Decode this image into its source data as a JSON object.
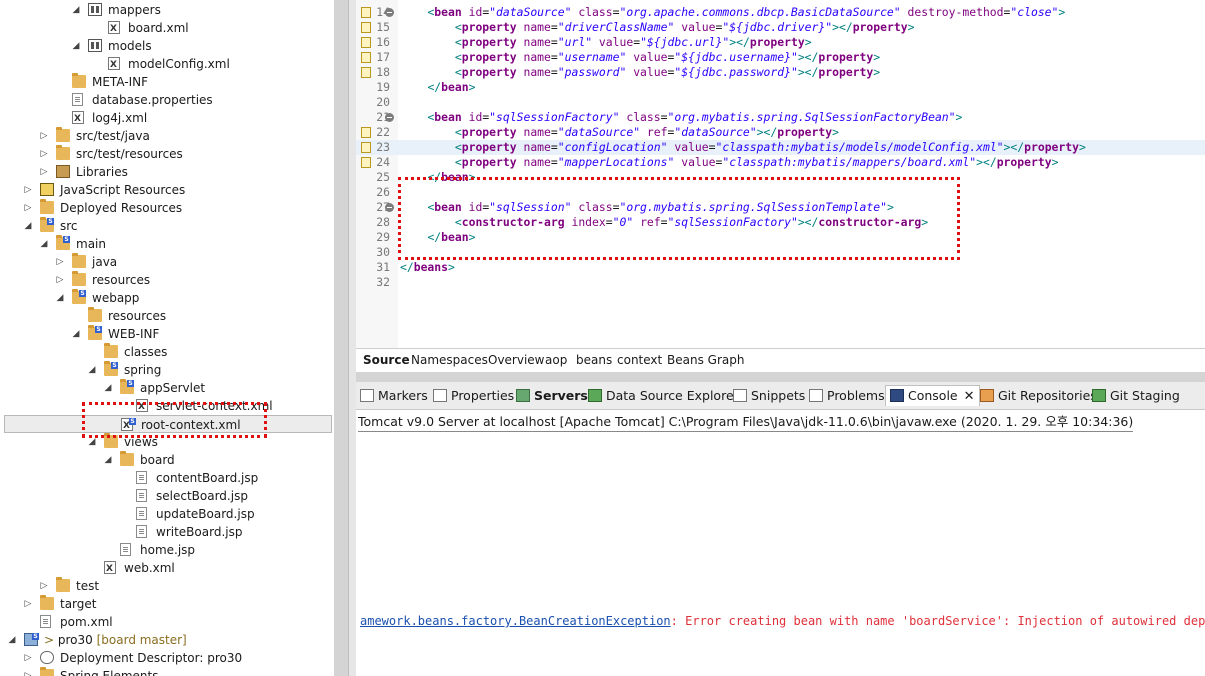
{
  "explorer": {
    "rows": [
      {
        "label": "mappers",
        "icon": "package-icon"
      },
      {
        "label": "board.xml",
        "icon": "xml-file-icon"
      },
      {
        "label": "models",
        "icon": "package-icon"
      },
      {
        "label": "modelConfig.xml",
        "icon": "xml-file-icon"
      },
      {
        "label": "META-INF",
        "icon": "folder-icon"
      },
      {
        "label": "database.properties",
        "icon": "file-icon"
      },
      {
        "label": "log4j.xml",
        "icon": "xml-file-icon"
      },
      {
        "label": "src/test/java",
        "icon": "source-folder-icon"
      },
      {
        "label": "src/test/resources",
        "icon": "source-folder-icon"
      },
      {
        "label": "Libraries",
        "icon": "library-icon"
      },
      {
        "label": "JavaScript Resources",
        "icon": "javascript-icon"
      },
      {
        "label": "Deployed Resources",
        "icon": "folder-icon"
      },
      {
        "label": "src",
        "icon": "folder-icon"
      },
      {
        "label": "main",
        "icon": "folder-icon"
      },
      {
        "label": "java",
        "icon": "folder-icon"
      },
      {
        "label": "resources",
        "icon": "folder-icon"
      },
      {
        "label": "webapp",
        "icon": "folder-icon"
      },
      {
        "label": "resources",
        "icon": "folder-icon"
      },
      {
        "label": "WEB-INF",
        "icon": "folder-icon"
      },
      {
        "label": "classes",
        "icon": "folder-icon"
      },
      {
        "label": "spring",
        "icon": "folder-icon"
      },
      {
        "label": "appServlet",
        "icon": "folder-icon"
      },
      {
        "label": "servlet-context.xml",
        "icon": "xml-file-icon"
      },
      {
        "label": "root-context.xml",
        "icon": "xml-file-icon"
      },
      {
        "label": "views",
        "icon": "folder-icon"
      },
      {
        "label": "board",
        "icon": "folder-icon"
      },
      {
        "label": "contentBoard.jsp",
        "icon": "file-icon"
      },
      {
        "label": "selectBoard.jsp",
        "icon": "file-icon"
      },
      {
        "label": "updateBoard.jsp",
        "icon": "file-icon"
      },
      {
        "label": "writeBoard.jsp",
        "icon": "file-icon"
      },
      {
        "label": "home.jsp",
        "icon": "file-icon"
      },
      {
        "label": "web.xml",
        "icon": "xml-file-icon"
      },
      {
        "label": "test",
        "icon": "folder-icon"
      },
      {
        "label": "target",
        "icon": "folder-icon"
      },
      {
        "label": "pom.xml",
        "icon": "maven-file-icon"
      },
      {
        "label": "pro30",
        "suffix": "[board master]",
        "prefix": ">",
        "icon": "project-icon"
      },
      {
        "label": "Deployment Descriptor: pro30",
        "icon": "descriptor-icon"
      },
      {
        "label": "Spring Elements",
        "icon": "spring-icon"
      }
    ]
  },
  "editor": {
    "lines": [
      {
        "n": "14",
        "code": ""
      },
      {
        "n": "15",
        "code": ""
      },
      {
        "n": "16",
        "code": ""
      },
      {
        "n": "17",
        "code": ""
      },
      {
        "n": "18",
        "code": ""
      },
      {
        "n": "19",
        "code": ""
      },
      {
        "n": "20",
        "code": ""
      },
      {
        "n": "21",
        "code": ""
      },
      {
        "n": "22",
        "code": ""
      },
      {
        "n": "23",
        "code": ""
      },
      {
        "n": "24",
        "code": ""
      },
      {
        "n": "25",
        "code": ""
      },
      {
        "n": "26",
        "code": ""
      },
      {
        "n": "27",
        "code": ""
      },
      {
        "n": "28",
        "code": ""
      },
      {
        "n": "29",
        "code": ""
      },
      {
        "n": "30",
        "code": ""
      },
      {
        "n": "31",
        "code": ""
      },
      {
        "n": "32",
        "code": ""
      }
    ],
    "code_text": [
      "    <bean id=\"dataSource\" class=\"org.apache.commons.dbcp.BasicDataSource\" destroy-method=\"close\">",
      "        <property name=\"driverClassName\" value=\"${jdbc.driver}\"></property>",
      "        <property name=\"url\" value=\"${jdbc.url}\"></property>",
      "        <property name=\"username\" value=\"${jdbc.username}\"></property>",
      "        <property name=\"password\" value=\"${jdbc.password}\"></property>",
      "    </bean>",
      "",
      "    <bean id=\"sqlSessionFactory\" class=\"org.mybatis.spring.SqlSessionFactoryBean\">",
      "        <property name=\"dataSource\" ref=\"dataSource\"></property>",
      "        <property name=\"configLocation\" value=\"classpath:mybatis/models/modelConfig.xml\"></property>",
      "        <property name=\"mapperLocations\" value=\"classpath:mybatis/mappers/board.xml\"></property>",
      "    </bean>",
      "",
      "    <bean id=\"sqlSession\" class=\"org.mybatis.spring.SqlSessionTemplate\">",
      "        <constructor-arg index=\"0\" ref=\"sqlSessionFactory\"></constructor-arg>",
      "    </bean>",
      "",
      "</beans>",
      ""
    ],
    "tabs": [
      "Source",
      "Namespaces",
      "Overview",
      "aop",
      "beans",
      "context",
      "Beans Graph"
    ],
    "active_tab": "Source"
  },
  "panel": {
    "tabs": [
      {
        "label": "Markers",
        "icon": "markers-icon"
      },
      {
        "label": "Properties",
        "icon": "properties-icon"
      },
      {
        "label": "Servers",
        "icon": "servers-icon"
      },
      {
        "label": "Data Source Explorer",
        "icon": "data-source-icon"
      },
      {
        "label": "Snippets",
        "icon": "snippets-icon"
      },
      {
        "label": "Problems",
        "icon": "problems-icon"
      },
      {
        "label": "Console",
        "icon": "console-icon"
      },
      {
        "label": "Git Repositories",
        "icon": "git-icon"
      },
      {
        "label": "Git Staging",
        "icon": "git-staging-icon"
      }
    ],
    "active_tab": "Console",
    "close_glyph": "✕"
  },
  "console": {
    "title": "Tomcat v9.0 Server at localhost [Apache Tomcat] C:\\Program Files\\Java\\jdk-11.0.6\\bin\\javaw.exe (2020. 1. 29. 오후 10:34:36)",
    "error_link": "amework.beans.factory.BeanCreationException",
    "error_text": ": Error creating bean with name 'boardService': Injection of autowired depende"
  },
  "colors": {
    "highlight_box": "#e01010",
    "xml_tag": "#3f7f7f",
    "xml_attr": "#7f007f",
    "xml_value": "#2a00ff",
    "error_text": "#e0303a"
  }
}
